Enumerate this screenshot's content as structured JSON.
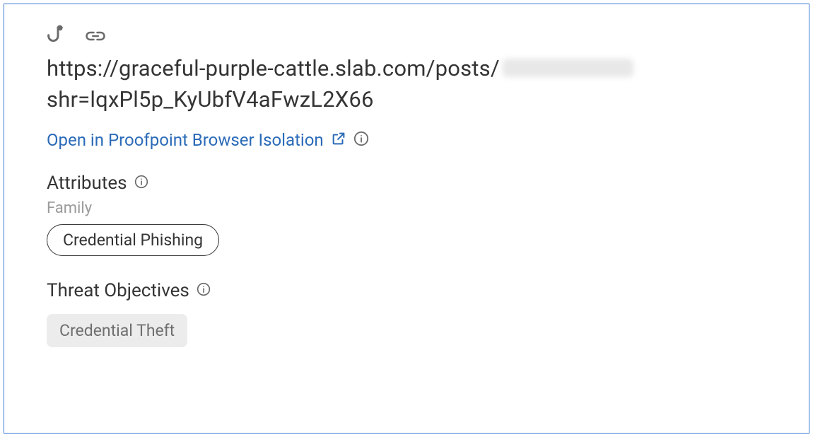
{
  "threat": {
    "url_line1": "https://graceful-purple-cattle.slab.com/posts/",
    "url_line1_redacted": true,
    "url_line2": "shr=lqxPl5p_KyUbfV4aFwzL2X66",
    "isolation_link_label": "Open in Proofpoint Browser Isolation",
    "attributes": {
      "heading": "Attributes",
      "family_label": "Family",
      "family_value": "Credential Phishing"
    },
    "objectives": {
      "heading": "Threat Objectives",
      "items": [
        "Credential Theft"
      ]
    }
  },
  "colors": {
    "link": "#2a6ab8",
    "border": "#3a7bd5",
    "muted": "#9b9b9b"
  }
}
